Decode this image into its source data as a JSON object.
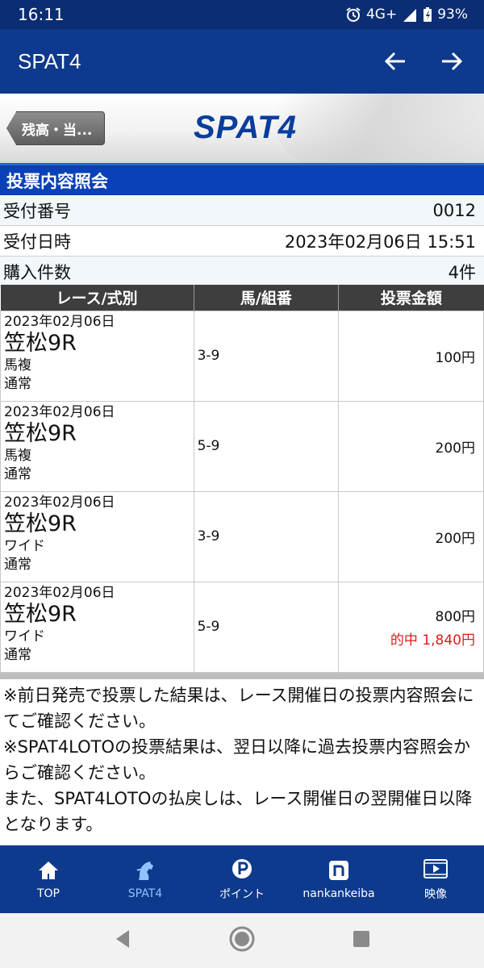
{
  "status_bar": {
    "time": "16:11",
    "network": "4G+",
    "battery": "93%"
  },
  "app_bar": {
    "title": "SPAT4",
    "back_icon": "arrow-left-icon",
    "forward_icon": "arrow-right-icon"
  },
  "banner": {
    "back_label": "残高・当...",
    "logo": "SPAT4"
  },
  "section": {
    "title": "投票内容照会"
  },
  "info": {
    "receipt_no_label": "受付番号",
    "receipt_no": "0012",
    "receipt_time_label": "受付日時",
    "receipt_time": "2023年02月06日 15:51",
    "count_label": "購入件数",
    "count": "4件"
  },
  "table": {
    "headers": [
      "レース/式別",
      "馬/組番",
      "投票金額"
    ],
    "rows": [
      {
        "date": "2023年02月06日",
        "race": "笠松9R",
        "type": "馬複",
        "mode": "通常",
        "combo": "3-9",
        "amount": "100円",
        "hit": ""
      },
      {
        "date": "2023年02月06日",
        "race": "笠松9R",
        "type": "馬複",
        "mode": "通常",
        "combo": "5-9",
        "amount": "200円",
        "hit": ""
      },
      {
        "date": "2023年02月06日",
        "race": "笠松9R",
        "type": "ワイド",
        "mode": "通常",
        "combo": "3-9",
        "amount": "200円",
        "hit": ""
      },
      {
        "date": "2023年02月06日",
        "race": "笠松9R",
        "type": "ワイド",
        "mode": "通常",
        "combo": "5-9",
        "amount": "800円",
        "hit": "的中 1,840円"
      }
    ]
  },
  "notes": {
    "note1": "※前日発売で投票した結果は、レース開催日の投票内容照会にてご確認ください。",
    "note2": "※SPAT4LOTOの投票結果は、翌日以降に過去投票内容照会からご確認ください。",
    "note3": "また、SPAT4LOTOの払戻しは、レース開催日の翌開催日以降となります。"
  },
  "bottom_nav": {
    "items": [
      {
        "label": "TOP",
        "icon": "home-icon"
      },
      {
        "label": "SPAT4",
        "icon": "horse-icon"
      },
      {
        "label": "ポイント",
        "icon": "point-icon"
      },
      {
        "label": "nankankeiba",
        "icon": "nankan-icon"
      },
      {
        "label": "映像",
        "icon": "video-icon"
      }
    ],
    "active_color": "#8fc2ff"
  },
  "colors": {
    "app_bar": "#0d3a8c",
    "section_header": "#0b41b8",
    "hit_text": "#e01a1a"
  }
}
